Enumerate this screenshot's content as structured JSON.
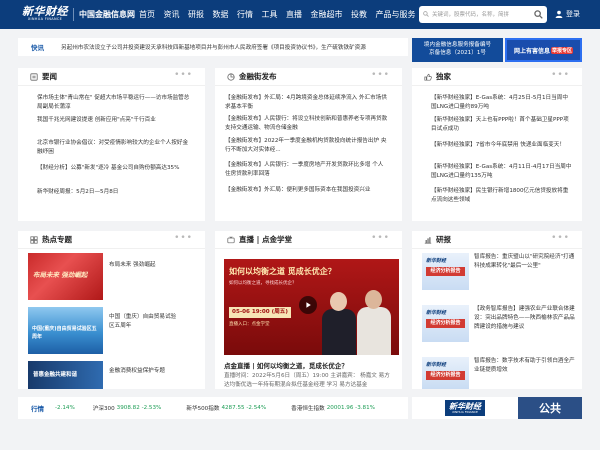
{
  "header": {
    "logo_main": "新华财经",
    "logo_sub": "XINHUA FINANCE",
    "site_name": "中国金融信息网",
    "nav": [
      {
        "label": "首页"
      },
      {
        "label": "资讯"
      },
      {
        "label": "研报"
      },
      {
        "label": "数据"
      },
      {
        "label": "行情"
      },
      {
        "label": "工具"
      },
      {
        "label": "直播"
      },
      {
        "label": "金融超市"
      },
      {
        "label": "投教"
      },
      {
        "label": "产品与服务"
      }
    ],
    "nav_caret": "▾",
    "search_placeholder": "关键词，股票代码，名称，简拼",
    "login_label": "登录"
  },
  "ticker": {
    "label": "快讯",
    "text": "另起州市农法设立子公司并投资建设天承科技四新基地项目并与彭州市人民政府签署《项目投资协议书》，生产硫铁铁矿资源"
  },
  "banners": {
    "service_line1": "境内金融信息服务报备编号",
    "service_line2": "京备信息（2021）1号",
    "investor_label": "网上有害信息",
    "investor_tag": "举报专区"
  },
  "sections": {
    "news": {
      "title": "要闻",
      "items": [
        "保市场主体\"青山常在\" 促超大市场平稳运行——访市场监管总局副局长蒲淳",
        "我国千兆光网建设提速 创新应用\"点亮\"千行百业",
        "北京市银行业协会倡议：对受疫情影响较大的企业个人按好金融纾困",
        "【财经分析】公募\"新发\"逐冷 基金公司自购份额高达35%",
        "新华财经周报：5月2日—5月8日"
      ]
    },
    "finance_street": {
      "title": "金融街发布",
      "items": [
        "【金融街发布】外汇局：4月跨境资金总体延续净流入 外汇市场供求基本平衡",
        "【金融街发布】人民银行：将设立科技创新和普惠养老专项再贷款支持交通运输、物流仓储金融",
        "【金融街发布】2022年一季度金融机构贷款投向统计报告出炉 央行不断加大对实体经...",
        "【金融街发布】人民银行：一季度房地产开发贷款环比多增 个人住房贷款利率回落",
        "【金融街发布】外汇局：便利更多国际资本在我国投资兴业"
      ]
    },
    "exclusive": {
      "title": "独家",
      "items": [
        "【新华财经独家】E-Gas系统：4月25日-5月1日当周中国LNG进口量约89万吨",
        "【新华财经独家】天上也有PPP啦！首个基础卫星PPP项目试点成功",
        "【新华财经独家】7省市今年底禁用 快递业面临变天！",
        "【新华财经独家】E-Gas系统：4月11日-4月17日当周中国LNG进口量约135万吨",
        "【新华财经独家】民生银行新增1800亿元信贷投放将重点流向这些领域"
      ]
    },
    "topics": {
      "title": "热点专题",
      "items": [
        {
          "label": "布局未来 强劲崛起",
          "thumb_text": "布局未来 强劲崛起"
        },
        {
          "label": "中国（重庆）自由贸易试验区五周年",
          "thumb_text": "中国(重庆)自由贸易试验区五周年"
        },
        {
          "label": "金融消费权益保护专题",
          "thumb_text": "普惠金融共建和谐"
        }
      ]
    },
    "live": {
      "title": "直播 | 点金学堂",
      "video_title": "如何以均衡之道 觅成长优企？",
      "video_sub": "如何以均衡之道，寻找成长优企？",
      "video_date": "05-06 19:00 (周五)",
      "video_live": "直播入口：点金学堂",
      "caption": "点金直播 | 如何以均衡之道，觅成长优企？",
      "description": "直播时间：2022年5月6日（周五）19:00 主讲嘉宾： 杨嘉文 易方达均衡优选一年持有期混合拟任基金经理 学习 易方达基金"
    },
    "research": {
      "title": "研报",
      "items": [
        {
          "thumb_title": "经济分析报告",
          "thumb_logo": "新华财经",
          "text": "智库报告：重庆璧山以\"研究院经济\"打通科技成果转化\"最后一公里\""
        },
        {
          "thumb_title": "经济分析报告",
          "thumb_logo": "新华财经",
          "text": "【政务智库报告】建强农业产业联合体建设：突出品牌特色——陕西榆林农产品品牌建设的措施与建议"
        },
        {
          "thumb_title": "经济分析报告",
          "thumb_logo": "新华财经",
          "text": "智库报告：数字技术有助于引领白酒全产业链提质增效"
        }
      ]
    }
  },
  "market": {
    "label": "行情",
    "items": [
      {
        "name": "",
        "value": "-2.14%"
      },
      {
        "name": "沪深300",
        "value": "3908.82 -2.53%"
      },
      {
        "name": "新华500指数",
        "value": "4287.55 -2.54%"
      },
      {
        "name": "香港恒生指数",
        "value": "20001.96 -3.81%"
      }
    ],
    "logo_main": "新华财经",
    "logo_sub": "XINHUA FINANCE",
    "public_label": "公共"
  },
  "colors": {
    "header_bg": "#0c3d7c",
    "accent_blue": "#1a5aa8",
    "market_down": "#1d9d55",
    "banner_tag": "#e83a36"
  },
  "icons": {
    "user": "user-icon",
    "search": "search-icon",
    "play": "play-icon",
    "more": "more-dots-icon",
    "news": "news-icon",
    "finance": "pie-chart-icon",
    "exclusive": "thumbs-up-icon",
    "topics": "topic-icon",
    "live": "live-tv-icon",
    "research": "research-icon"
  }
}
